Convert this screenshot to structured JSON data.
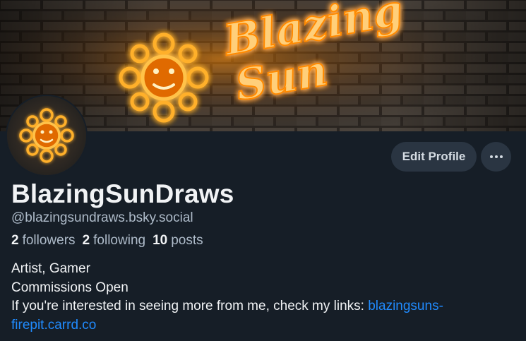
{
  "banner": {
    "sign_text_1": "Blazing",
    "sign_text_2": "Sun"
  },
  "profile": {
    "display_name": "BlazingSunDraws",
    "handle": "@blazingsundraws.bsky.social",
    "stats": [
      {
        "count": "2",
        "label": "followers"
      },
      {
        "count": "2",
        "label": "following"
      },
      {
        "count": "10",
        "label": "posts"
      }
    ],
    "bio_lines": [
      "Artist, Gamer",
      "Commissions Open"
    ],
    "bio_last_prefix": "If you're interested in seeing more from me, check my links: ",
    "bio_link_part1": "blazingsuns-",
    "bio_link_part2": "firepit.carrd.co"
  },
  "actions": {
    "edit_label": "Edit Profile"
  },
  "icons": {
    "more": "more-horizontal-icon",
    "banner_logo": "sun-logo-icon",
    "avatar_logo": "sun-logo-icon"
  },
  "colors": {
    "background": "#161e27",
    "link": "#208bfe",
    "neon_orange": "#ffa21a",
    "button": "#2a3542"
  }
}
